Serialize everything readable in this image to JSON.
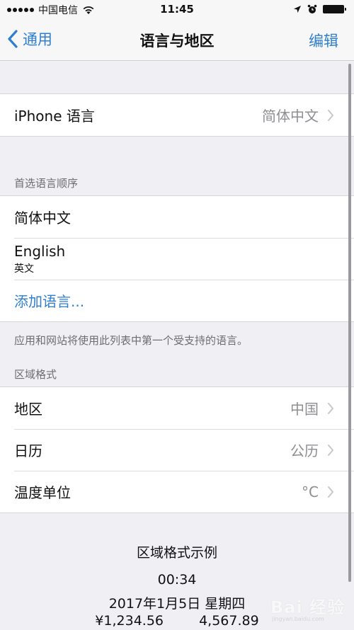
{
  "status_bar": {
    "carrier": "中国电信",
    "time": "11:45",
    "icons": [
      "signal-dots-icon",
      "wifi-icon",
      "location-arrow-icon",
      "alarm-clock-icon",
      "battery-icon"
    ]
  },
  "nav": {
    "back_label": "通用",
    "title": "语言与地区",
    "edit_label": "编辑",
    "accent_color": "#2f7fce"
  },
  "iphone_language": {
    "label": "iPhone 语言",
    "value": "简体中文"
  },
  "preferred_languages": {
    "header": "首选语言顺序",
    "items": [
      {
        "label": "简体中文",
        "sublabel": ""
      },
      {
        "label": "English",
        "sublabel": "英文"
      }
    ],
    "add_label": "添加语言...",
    "footer": "应用和网站将使用此列表中第一个受支持的语言。"
  },
  "region_format": {
    "header": "区域格式",
    "rows": [
      {
        "label": "地区",
        "value": "中国"
      },
      {
        "label": "日历",
        "value": "公历"
      },
      {
        "label": "温度单位",
        "value": "°C"
      }
    ]
  },
  "format_example": {
    "title": "区域格式示例",
    "time": "00:34",
    "date": "2017年1月5日 星期四",
    "currency": "¥1,234.56",
    "number": "4,567.89"
  },
  "watermark": {
    "text": "Bai 经验",
    "sub": "jingyan.baidu.com"
  }
}
